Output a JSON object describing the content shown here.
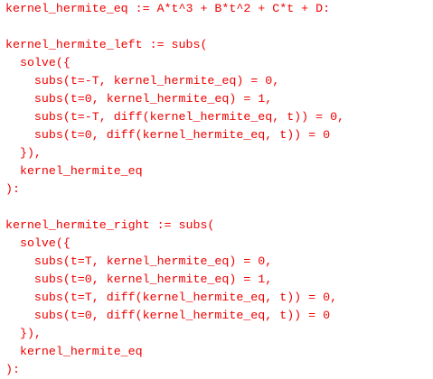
{
  "code_lines": [
    "kernel_hermite_eq := A*t^3 + B*t^2 + C*t + D:",
    "",
    "kernel_hermite_left := subs(",
    "  solve({",
    "    subs(t=-T, kernel_hermite_eq) = 0,",
    "    subs(t=0, kernel_hermite_eq) = 1,",
    "    subs(t=-T, diff(kernel_hermite_eq, t)) = 0,",
    "    subs(t=0, diff(kernel_hermite_eq, t)) = 0",
    "  }),",
    "  kernel_hermite_eq",
    "):",
    "",
    "kernel_hermite_right := subs(",
    "  solve({",
    "    subs(t=T, kernel_hermite_eq) = 0,",
    "    subs(t=0, kernel_hermite_eq) = 1,",
    "    subs(t=T, diff(kernel_hermite_eq, t)) = 0,",
    "    subs(t=0, diff(kernel_hermite_eq, t)) = 0",
    "  }),",
    "  kernel_hermite_eq",
    "):"
  ],
  "colors": {
    "text": "#ee0000",
    "background": "#ffffff"
  }
}
